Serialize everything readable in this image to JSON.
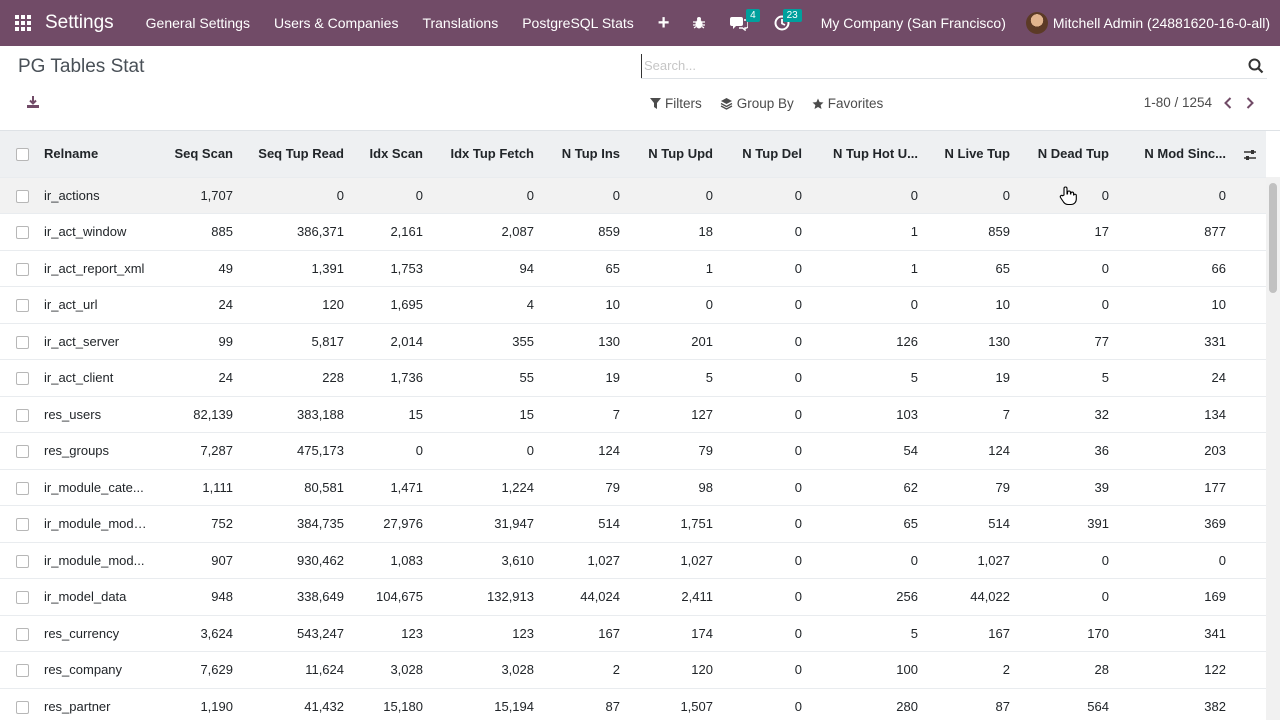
{
  "navbar": {
    "app_name": "Settings",
    "menus": [
      "General Settings",
      "Users & Companies",
      "Translations",
      "PostgreSQL Stats"
    ],
    "add_label": "+",
    "messages_count": "4",
    "activities_count": "23",
    "company": "My Company (San Francisco)",
    "user": "Mitchell Admin (24881620-16-0-all)",
    "accent_color": "#714B67",
    "badge_color": "#00A09D"
  },
  "control": {
    "title": "PG Tables Stat",
    "search_placeholder": "Search...",
    "filters_label": "Filters",
    "groupby_label": "Group By",
    "favorites_label": "Favorites",
    "pager": "1-80 / 1254"
  },
  "table": {
    "columns": [
      "Relname",
      "Seq Scan",
      "Seq Tup Read",
      "Idx Scan",
      "Idx Tup Fetch",
      "N Tup Ins",
      "N Tup Upd",
      "N Tup Del",
      "N Tup Hot U...",
      "N Live Tup",
      "N Dead Tup",
      "N Mod Sinc..."
    ],
    "rows": [
      [
        "ir_actions",
        "1,707",
        "0",
        "0",
        "0",
        "0",
        "0",
        "0",
        "0",
        "0",
        "0",
        "0"
      ],
      [
        "ir_act_window",
        "885",
        "386,371",
        "2,161",
        "2,087",
        "859",
        "18",
        "0",
        "1",
        "859",
        "17",
        "877"
      ],
      [
        "ir_act_report_xml",
        "49",
        "1,391",
        "1,753",
        "94",
        "65",
        "1",
        "0",
        "1",
        "65",
        "0",
        "66"
      ],
      [
        "ir_act_url",
        "24",
        "120",
        "1,695",
        "4",
        "10",
        "0",
        "0",
        "0",
        "10",
        "0",
        "10"
      ],
      [
        "ir_act_server",
        "99",
        "5,817",
        "2,014",
        "355",
        "130",
        "201",
        "0",
        "126",
        "130",
        "77",
        "331"
      ],
      [
        "ir_act_client",
        "24",
        "228",
        "1,736",
        "55",
        "19",
        "5",
        "0",
        "5",
        "19",
        "5",
        "24"
      ],
      [
        "res_users",
        "82,139",
        "383,188",
        "15",
        "15",
        "7",
        "127",
        "0",
        "103",
        "7",
        "32",
        "134"
      ],
      [
        "res_groups",
        "7,287",
        "475,173",
        "0",
        "0",
        "124",
        "79",
        "0",
        "54",
        "124",
        "36",
        "203"
      ],
      [
        "ir_module_cate...",
        "1,111",
        "80,581",
        "1,471",
        "1,224",
        "79",
        "98",
        "0",
        "62",
        "79",
        "39",
        "177"
      ],
      [
        "ir_module_module",
        "752",
        "384,735",
        "27,976",
        "31,947",
        "514",
        "1,751",
        "0",
        "65",
        "514",
        "391",
        "369"
      ],
      [
        "ir_module_mod...",
        "907",
        "930,462",
        "1,083",
        "3,610",
        "1,027",
        "1,027",
        "0",
        "0",
        "1,027",
        "0",
        "0"
      ],
      [
        "ir_model_data",
        "948",
        "338,649",
        "104,675",
        "132,913",
        "44,024",
        "2,411",
        "0",
        "256",
        "44,022",
        "0",
        "169"
      ],
      [
        "res_currency",
        "3,624",
        "543,247",
        "123",
        "123",
        "167",
        "174",
        "0",
        "5",
        "167",
        "170",
        "341"
      ],
      [
        "res_company",
        "7,629",
        "11,624",
        "3,028",
        "3,028",
        "2",
        "120",
        "0",
        "100",
        "2",
        "28",
        "122"
      ],
      [
        "res_partner",
        "1,190",
        "41,432",
        "15,180",
        "15,194",
        "87",
        "1,507",
        "0",
        "280",
        "87",
        "564",
        "382"
      ]
    ]
  }
}
